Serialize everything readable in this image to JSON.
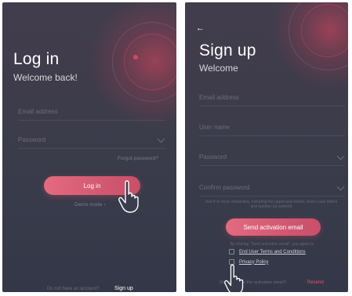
{
  "login": {
    "title": "Log in",
    "subtitle": "Welcome back!",
    "email_placeholder": "Email address",
    "password_placeholder": "Password",
    "forgot_password": "Forgot password?",
    "login_button": "Log in",
    "demo_link": "Demo mode ›",
    "footer_text": "Do not have an account?",
    "footer_link": "Sign up"
  },
  "signup": {
    "back_icon": "←",
    "title": "Sign up",
    "subtitle": "Welcome",
    "email_placeholder": "Email address",
    "username_placeholder": "User name",
    "password_placeholder": "Password",
    "confirm_placeholder": "Confirm password",
    "password_hint": "Use 8 or more characters, including the uppercase letters, lower case letters and number (at symbol)",
    "send_button": "Send activation email",
    "agree_text": "By clicking \"Send activation email\", you agree to",
    "terms_link": "End User Terms and Conditions",
    "privacy_link": "Privacy Policy",
    "footer_text": "Didn't receive the activation email?",
    "resend_link": "Resend"
  },
  "icons": {
    "back": "arrow-left-icon",
    "chevron": "chevron-down-icon",
    "pointer": "hand-pointer-icon"
  },
  "colors": {
    "accent": "#dc5a72",
    "background": "#3b3c4b",
    "text_primary": "#ffffff",
    "text_muted": "#6f6b7a"
  }
}
